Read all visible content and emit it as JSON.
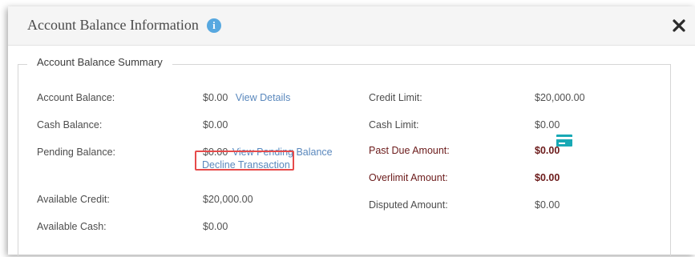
{
  "modal": {
    "title": "Account Balance Information",
    "info_icon_glyph": "i",
    "close_icon": "close-icon"
  },
  "summary": {
    "legend": "Account Balance Summary",
    "left": {
      "account_balance_label": "Account Balance:",
      "account_balance_value": "$0.00",
      "view_details_link": "View Details",
      "cash_balance_label": "Cash Balance:",
      "cash_balance_value": "$0.00",
      "pending_balance_label": "Pending Balance:",
      "pending_balance_value": "$0.00",
      "view_pending_balance_link": "View Pending Balance",
      "decline_transaction_link": "Decline Transaction",
      "available_credit_label": "Available Credit:",
      "available_credit_value": "$20,000.00",
      "available_cash_label": "Available Cash:",
      "available_cash_value": "$0.00"
    },
    "right": {
      "credit_limit_label": "Credit Limit:",
      "credit_limit_value": "$20,000.00",
      "cash_limit_label": "Cash Limit:",
      "cash_limit_value": "$0.00",
      "past_due_amount_label": "Past Due Amount:",
      "past_due_amount_value": "$0.00",
      "past_due_icon": "credit-card-icon",
      "overlimit_amount_label": "Overlimit Amount:",
      "overlimit_amount_value": "$0.00",
      "disputed_amount_label": "Disputed Amount:",
      "disputed_amount_value": "$0.00"
    }
  },
  "colors": {
    "link": "#5a88bd",
    "alert_text": "#6b1a1a",
    "highlight_box": "#e64b4b",
    "info_icon": "#57a8e0",
    "card_icon": "#18a9b5"
  }
}
